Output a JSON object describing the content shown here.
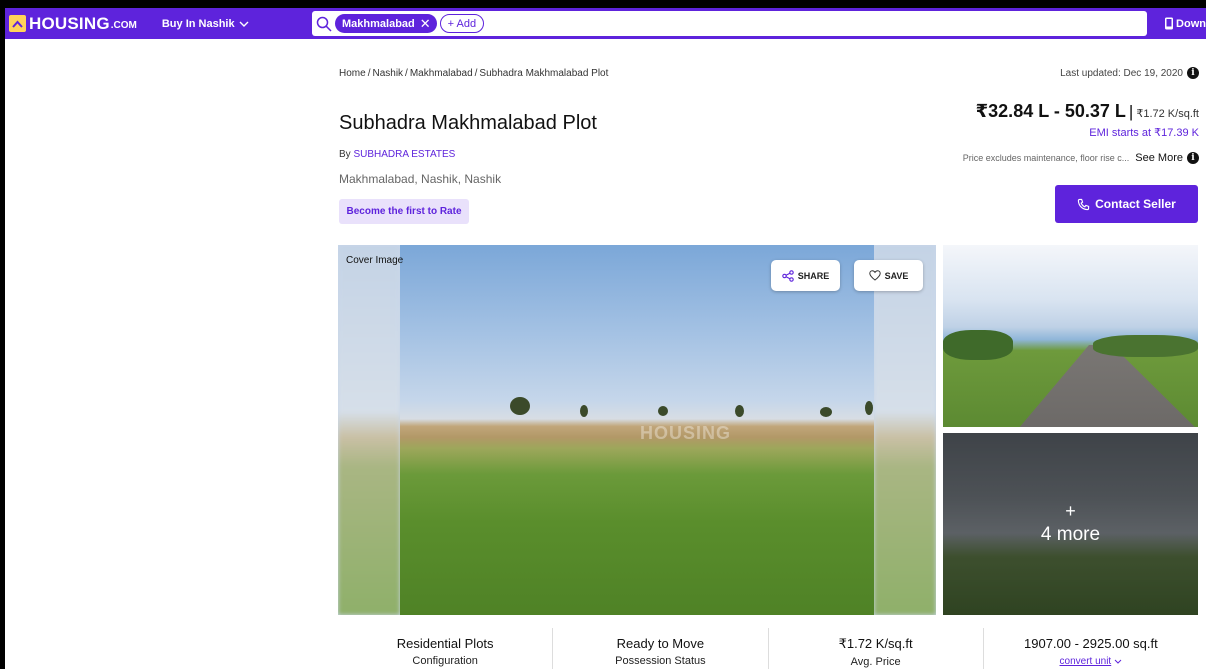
{
  "header": {
    "logo_text": "HOUSING",
    "logo_suffix": ".COM",
    "city_selector": "Buy In Nashik",
    "search_chip": "Makhmalabad",
    "add_chip": "+ Add",
    "download_label": "Down"
  },
  "breadcrumb": {
    "items": [
      "Home",
      "Nashik",
      "Makhmalabad",
      "Subhadra Makhmalabad Plot"
    ],
    "separator": "/"
  },
  "last_updated": "Last updated: Dec 19, 2020",
  "listing": {
    "title": "Subhadra Makhmalabad Plot",
    "by_prefix": "By",
    "developer": "SUBHADRA ESTATES",
    "locality": "Makhmalabad, Nashik, Nashik",
    "rate_label": "Become the first to Rate"
  },
  "pricing": {
    "range": "₹32.84 L - 50.37 L",
    "separator": "|",
    "per_sqft": "₹1.72 K/sq.ft",
    "emi": "EMI starts at ₹17.39 K",
    "note": "Price excludes maintenance, floor rise c...",
    "see_more": "See More",
    "info_glyph": "i"
  },
  "contact_label": "Contact Seller",
  "gallery": {
    "cover_label": "Cover Image",
    "share_label": "SHARE",
    "save_label": "SAVE",
    "watermark": "HOUSING",
    "more_plus": "+",
    "more_label": "4 more"
  },
  "overview": [
    {
      "value": "Residential Plots",
      "label": "Configuration"
    },
    {
      "value": "Ready to Move",
      "label": "Possession Status"
    },
    {
      "value": "₹1.72 K/sq.ft",
      "label": "Avg. Price"
    },
    {
      "value": "1907.00 - 2925.00 sq.ft",
      "link": "convert unit"
    }
  ],
  "colors": {
    "brand": "#5e23dc",
    "brand_light": "#e9e1fb",
    "logo_accent": "#ffd45a"
  },
  "icons": {
    "logo": "house-logo-icon",
    "city_dropdown": "chevron-down-icon",
    "search": "search-icon",
    "chip_remove": "close-icon",
    "download": "phone-icon",
    "info": "info-icon",
    "contact": "phone-call-icon",
    "share": "share-icon",
    "save": "heart-icon"
  }
}
